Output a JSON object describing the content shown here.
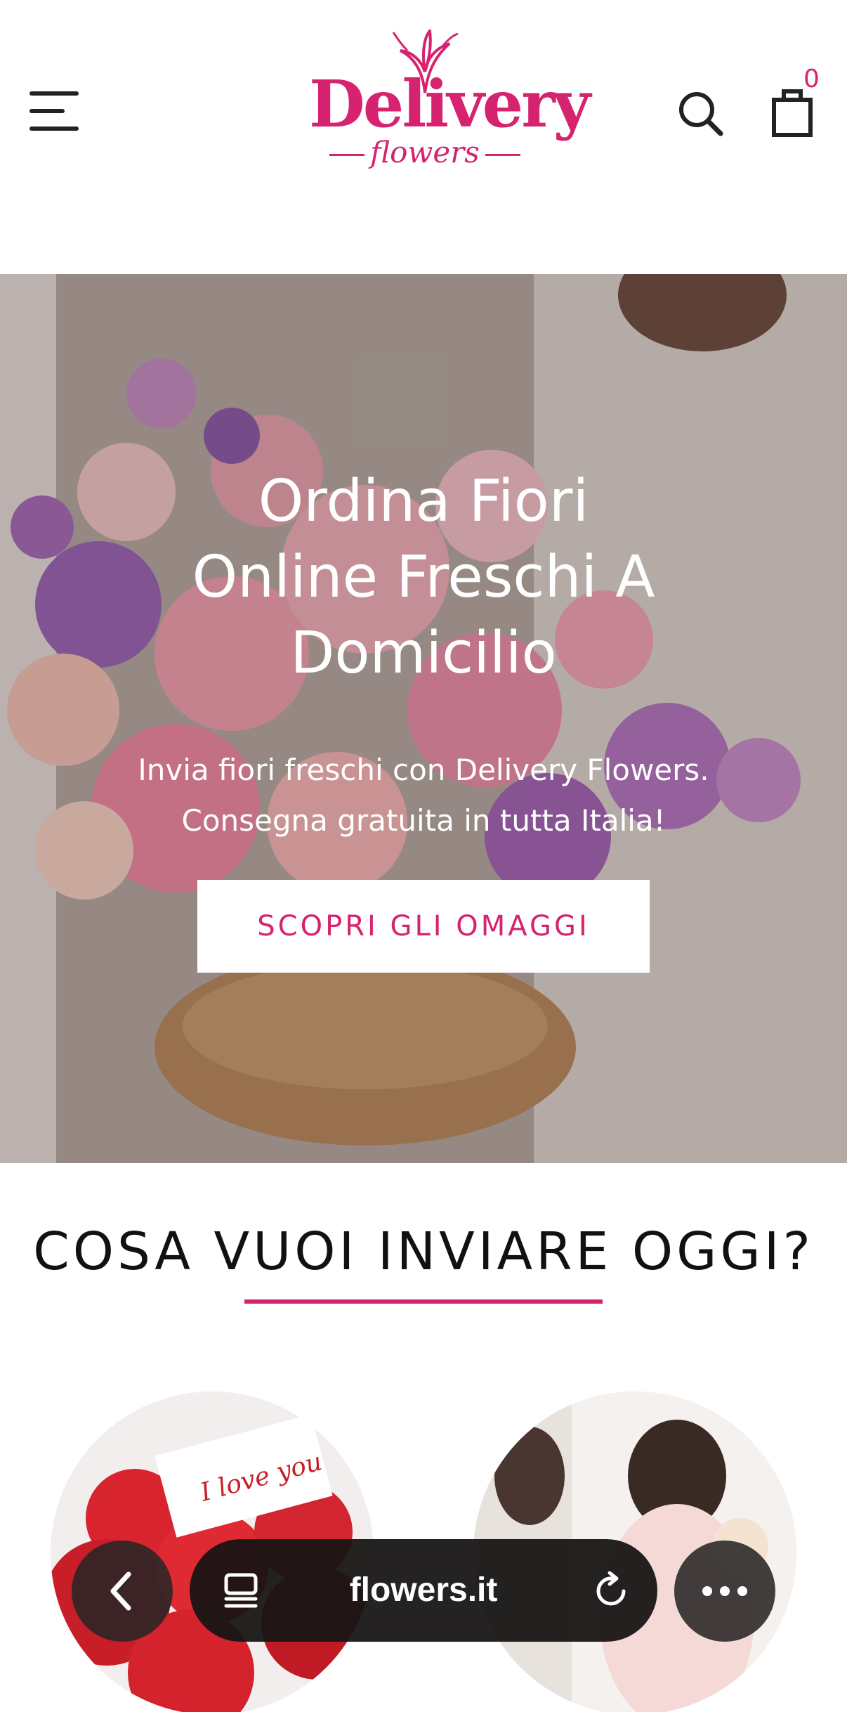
{
  "header": {
    "logo_text": "Delivery",
    "logo_subtext": "flowers",
    "cart_count": "0",
    "icons": [
      "menu-icon",
      "search-icon",
      "shopping-bag-icon"
    ]
  },
  "hero": {
    "title_line1": "Ordina Fiori",
    "title_line2": "Online Freschi A",
    "title_line3": "Domicilio",
    "subtitle_line1": "Invia fiori freschi con Delivery Flowers.",
    "subtitle_line2": "Consegna gratuita in tutta Italia!",
    "cta_label": "SCOPRI GLI OMAGGI"
  },
  "section": {
    "title": "COSA VUOI INVIARE OGGI?",
    "left_card_note": "I love you"
  },
  "browser": {
    "url": "flowers.it",
    "icons": [
      "back-icon",
      "tabs-icon",
      "reload-icon",
      "more-icon"
    ]
  },
  "colors": {
    "brand": "#d6236f",
    "text": "#111111"
  }
}
